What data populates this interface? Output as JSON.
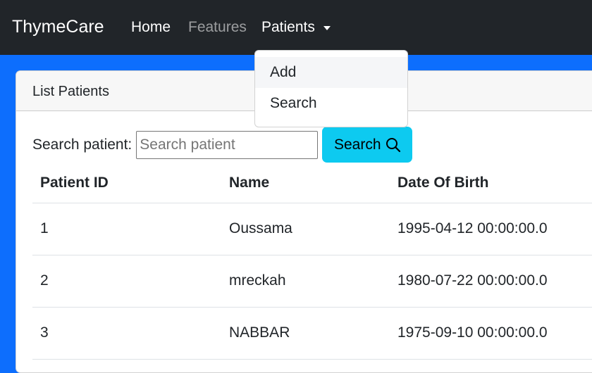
{
  "navbar": {
    "brand": "ThymeCare",
    "links": [
      "Home",
      "Features",
      "Patients"
    ]
  },
  "dropdown": {
    "items": [
      "Add",
      "Search"
    ]
  },
  "card": {
    "header": "List Patients",
    "search_label": "Search patient:",
    "search_placeholder": "Search patient",
    "search_button": "Search"
  },
  "table": {
    "headers": [
      "Patient ID",
      "Name",
      "Date Of Birth"
    ],
    "rows": [
      [
        "1",
        "Oussama",
        "1995-04-12 00:00:00.0"
      ],
      [
        "2",
        "mreckah",
        "1980-07-22 00:00:00.0"
      ],
      [
        "3",
        "NABBAR",
        "1975-09-10 00:00:00.0"
      ]
    ]
  },
  "colors": {
    "navbar_bg": "#212529",
    "page_bg": "#0d6efd",
    "search_button": "#0dcaf0"
  }
}
